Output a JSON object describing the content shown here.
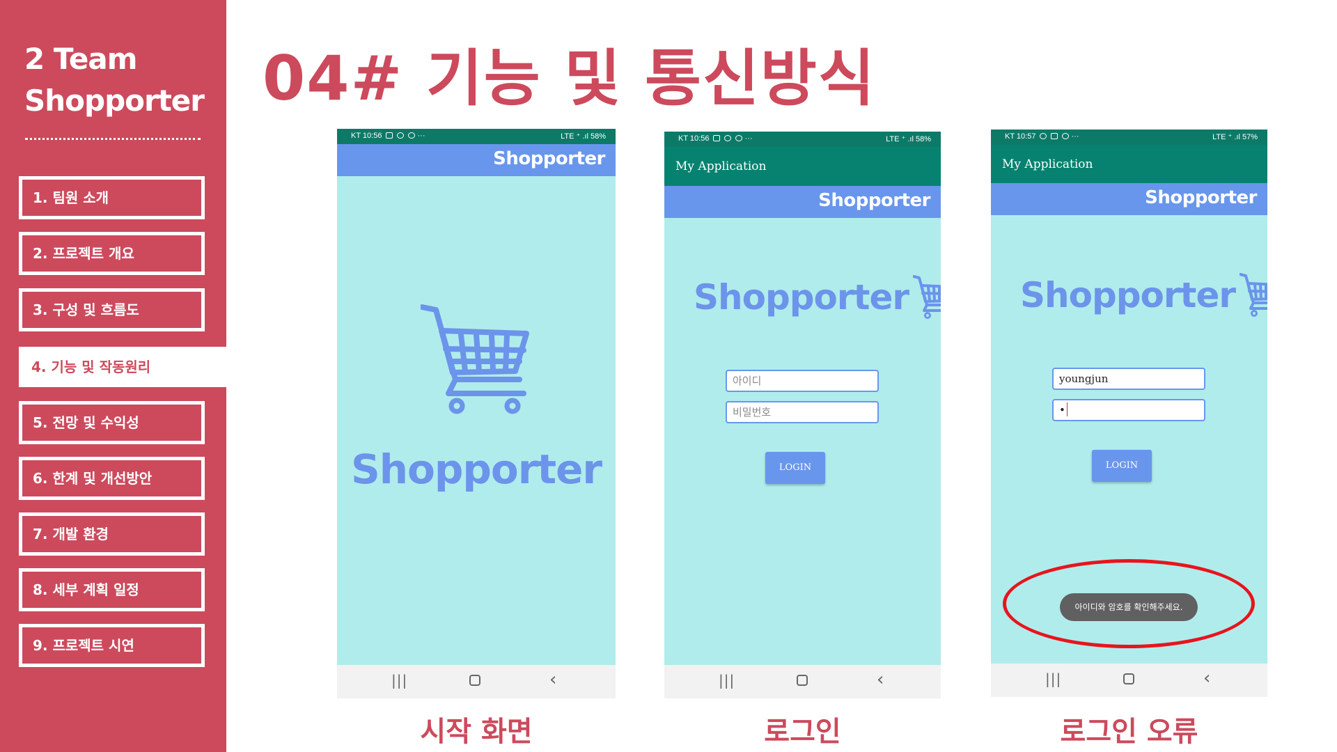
{
  "sidebar": {
    "team_line1": "2 Team",
    "team_line2": "Shopporter",
    "items": [
      {
        "label": "1. 팀원 소개"
      },
      {
        "label": "2. 프로젝트 개요"
      },
      {
        "label": "3. 구성 및 흐름도"
      },
      {
        "label": "4. 기능 및 작동원리"
      },
      {
        "label": "5. 전망 및 수익성"
      },
      {
        "label": "6. 한계 및 개선방안"
      },
      {
        "label": "7. 개발 환경"
      },
      {
        "label": "8. 세부 계획 일정"
      },
      {
        "label": "9. 프로젝트 시연"
      }
    ],
    "active_index": 3
  },
  "page": {
    "title": "04# 기능 및 통신방식"
  },
  "phones": [
    {
      "status_left": "KT 10:56",
      "status_right": "LTE ⁺ .ıl 58%",
      "brand_bar": "Shopporter",
      "logo": "Shopporter",
      "caption": "시작 화면"
    },
    {
      "status_left": "KT 10:56",
      "status_right": "LTE ⁺ .ıl 58%",
      "app_bar": "My Application",
      "brand_bar": "Shopporter",
      "logo": "Shopporter",
      "id_placeholder": "아이디",
      "pw_placeholder": "비밀번호",
      "login_label": "LOGIN",
      "caption": "로그인"
    },
    {
      "status_left": "KT 10:57",
      "status_right": "LTE ⁺ .ıl 57%",
      "app_bar": "My Application",
      "brand_bar": "Shopporter",
      "logo": "Shopporter",
      "id_value": "youngjun",
      "pw_value": "•",
      "login_label": "LOGIN",
      "toast": "아이디와 암호를 확인해주세요.",
      "caption": "로그인 오류"
    }
  ],
  "nav_icons": [
    "recent-apps-icon",
    "home-icon",
    "back-icon"
  ],
  "colors": {
    "brand_red": "#cc4a5c",
    "app_teal": "#0d7a68",
    "brand_blue": "#6896ec",
    "screen_bg": "#b0ecec",
    "highlight_red": "#e8141c"
  }
}
